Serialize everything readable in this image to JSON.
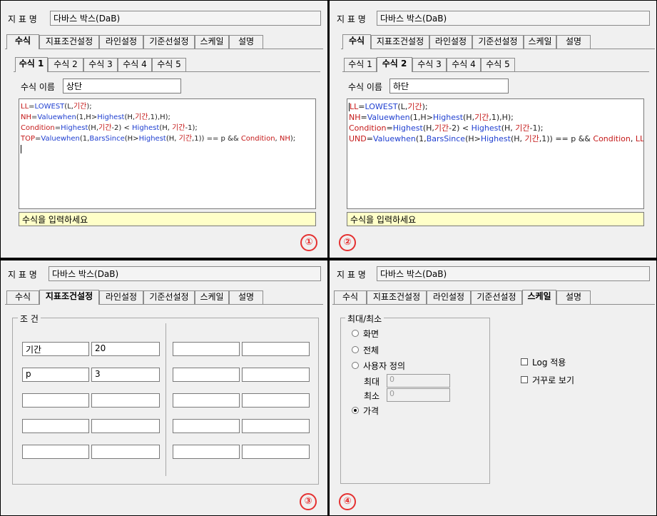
{
  "indicator_label": "지 표 명",
  "indicator_name": "다바스 박스(DaB)",
  "main_tabs": [
    "수식",
    "지표조건설정",
    "라인설정",
    "기준선설정",
    "스케일",
    "설명"
  ],
  "formula_tabs": [
    "수식 1",
    "수식 2",
    "수식 3",
    "수식 4",
    "수식 5"
  ],
  "formula_name_label": "수식 이름",
  "hint": "수식을 입력하세요",
  "panel1": {
    "formula_name": "상단",
    "lines": [
      [
        [
          "LL",
          "var"
        ],
        [
          "=",
          "nm"
        ],
        [
          "LOWEST",
          "kw"
        ],
        [
          "(L,",
          "nm"
        ],
        [
          "기간",
          "var"
        ],
        [
          ");",
          "nm"
        ]
      ],
      [
        [
          "NH",
          "var"
        ],
        [
          "=",
          "nm"
        ],
        [
          "Valuewhen",
          "kw"
        ],
        [
          "(1,H>",
          "nm"
        ],
        [
          "Highest",
          "kw"
        ],
        [
          "(H,",
          "nm"
        ],
        [
          "기간",
          "var"
        ],
        [
          ",1),H);",
          "nm"
        ]
      ],
      [
        [
          "Condition",
          "var"
        ],
        [
          "=",
          "nm"
        ],
        [
          "Highest",
          "kw"
        ],
        [
          "(H,",
          "nm"
        ],
        [
          "기간",
          "var"
        ],
        [
          "-2) < ",
          "nm"
        ],
        [
          "Highest",
          "kw"
        ],
        [
          "(H, ",
          "nm"
        ],
        [
          "기간",
          "var"
        ],
        [
          "-1);",
          "nm"
        ]
      ],
      [
        [
          "TOP",
          "var"
        ],
        [
          "=",
          "nm"
        ],
        [
          "Valuewhen",
          "kw"
        ],
        [
          "(1,",
          "nm"
        ],
        [
          "BarsSince",
          "kw"
        ],
        [
          "(H>",
          "nm"
        ],
        [
          "Highest",
          "kw"
        ],
        [
          "(H, ",
          "nm"
        ],
        [
          "기간",
          "var"
        ],
        [
          ",1)) == p && ",
          "nm"
        ],
        [
          "Condition",
          "var"
        ],
        [
          ", ",
          "nm"
        ],
        [
          "NH",
          "var"
        ],
        [
          ");",
          "nm"
        ]
      ]
    ],
    "badge": "①"
  },
  "panel2": {
    "formula_name": "하단",
    "lines": [
      [
        [
          "LL",
          "var"
        ],
        [
          "=",
          "nm"
        ],
        [
          "LOWEST",
          "kw"
        ],
        [
          "(L,",
          "nm"
        ],
        [
          "기간",
          "var"
        ],
        [
          ");",
          "nm"
        ]
      ],
      [
        [
          "NH",
          "var"
        ],
        [
          "=",
          "nm"
        ],
        [
          "Valuewhen",
          "kw"
        ],
        [
          "(1,H>",
          "nm"
        ],
        [
          "Highest",
          "kw"
        ],
        [
          "(H,",
          "nm"
        ],
        [
          "기간",
          "var"
        ],
        [
          ",1),H);",
          "nm"
        ]
      ],
      [
        [
          "Condition",
          "var"
        ],
        [
          "=",
          "nm"
        ],
        [
          "Highest",
          "kw"
        ],
        [
          "(H,",
          "nm"
        ],
        [
          "기간",
          "var"
        ],
        [
          "-2) < ",
          "nm"
        ],
        [
          "Highest",
          "kw"
        ],
        [
          "(H, ",
          "nm"
        ],
        [
          "기간",
          "var"
        ],
        [
          "-1);",
          "nm"
        ]
      ],
      [
        [
          "UND",
          "var"
        ],
        [
          "=",
          "nm"
        ],
        [
          "Valuewhen",
          "kw"
        ],
        [
          "(1,",
          "nm"
        ],
        [
          "BarsSince",
          "kw"
        ],
        [
          "(H>",
          "nm"
        ],
        [
          "Highest",
          "kw"
        ],
        [
          "(H, ",
          "nm"
        ],
        [
          "기간",
          "var"
        ],
        [
          ",1)) == p && ",
          "nm"
        ],
        [
          "Condition",
          "var"
        ],
        [
          ", ",
          "nm"
        ],
        [
          "LL",
          "var"
        ],
        [
          ");",
          "nm"
        ]
      ]
    ],
    "badge": "②"
  },
  "panel3": {
    "group_title": "조 건",
    "conditions": [
      {
        "name": "기간",
        "value": "20"
      },
      {
        "name": "p",
        "value": "3"
      },
      {
        "name": "",
        "value": ""
      },
      {
        "name": "",
        "value": ""
      },
      {
        "name": "",
        "value": ""
      }
    ],
    "badge": "③"
  },
  "panel4": {
    "group_title": "최대/최소",
    "radio_screen": "화면",
    "radio_all": "전체",
    "radio_user": "사용자 정의",
    "max_label": "최대",
    "max_value": "0",
    "min_label": "최소",
    "min_value": "0",
    "radio_price": "가격",
    "selected": "가격",
    "log_label": "Log 적용",
    "reverse_label": "거꾸로 보기",
    "badge": "④"
  },
  "colors": {
    "keyword": "#1f3fd0",
    "variable": "#c41818",
    "badge": "#e53030",
    "hint_bg": "#ffffc8"
  }
}
